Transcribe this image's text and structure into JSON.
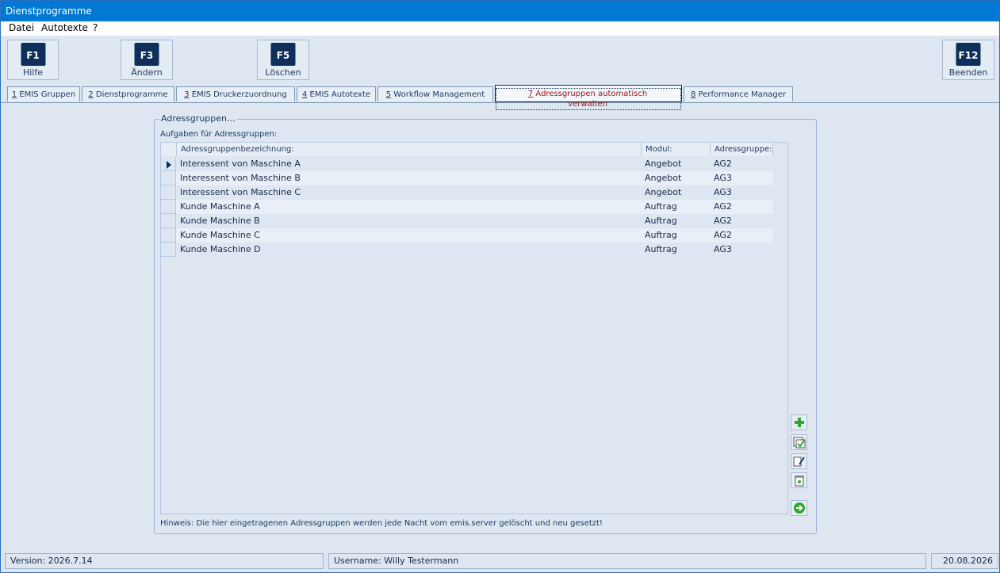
{
  "window": {
    "title": "Dienstprogramme"
  },
  "menu": [
    "Datei",
    "Autotexte",
    "?"
  ],
  "toolbar": [
    {
      "key": "F1",
      "label": "Hilfe"
    },
    {
      "key": "F3",
      "label": "Ändern"
    },
    {
      "key": "F5",
      "label": "Löschen"
    },
    {
      "key": "F12",
      "label": "Beenden"
    }
  ],
  "tabs": [
    {
      "num": "1",
      "label": " EMIS Gruppen"
    },
    {
      "num": "2",
      "label": " Dienstprogramme"
    },
    {
      "num": "3",
      "label": " EMIS Druckerzuordnung"
    },
    {
      "num": "4",
      "label": " EMIS Autotexte"
    },
    {
      "num": "5",
      "label": " Workflow Management"
    },
    {
      "num": "7",
      "label": " Adressgruppen automatisch verwalten"
    },
    {
      "num": "8",
      "label": " Performance Manager"
    }
  ],
  "group": {
    "title": "Adressgruppen...",
    "subtitle": "Aufgaben für Adressgruppen:",
    "columns": [
      "Adressgruppenbezeichnung:",
      "Modul:",
      "Adressgruppe:"
    ],
    "rows": [
      [
        "Interessent von Maschine A",
        "Angebot",
        "AG2"
      ],
      [
        "Interessent von Maschine B",
        "Angebot",
        "AG3"
      ],
      [
        "Interessent von Maschine C",
        "Angebot",
        "AG3"
      ],
      [
        "Kunde Maschine A",
        "Auftrag",
        "AG2"
      ],
      [
        "Kunde Maschine B",
        "Auftrag",
        "AG2"
      ],
      [
        "Kunde Maschine C",
        "Auftrag",
        "AG2"
      ],
      [
        "Kunde Maschine D",
        "Auftrag",
        "AG3"
      ]
    ],
    "hint": "Hinweis: Die hier eingetragenen Adressgruppen werden jede Nacht vom emis.server gelöscht und neu gesetzt!",
    "side_icons": [
      "add-icon",
      "check-list-icon",
      "edit-note-icon",
      "trash-icon",
      "forward-arrow-icon"
    ]
  },
  "status": {
    "version": "Version: 2026.7.14",
    "user": "Username: Willy Testermann",
    "date": "20.08.2026"
  },
  "colors": {
    "accent": "#0078d4",
    "key_bg": "#0d2f5a",
    "active_tab_text": "#a01a1a"
  }
}
